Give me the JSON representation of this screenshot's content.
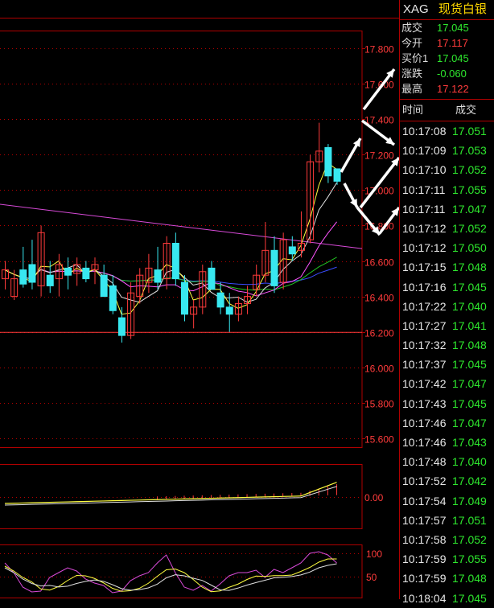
{
  "instrument": {
    "code": "XAG",
    "name": "现货白银"
  },
  "quote": [
    {
      "label": "成交",
      "value": "17.045",
      "color": "green"
    },
    {
      "label": "今开",
      "value": "17.117",
      "color": "red"
    },
    {
      "label": "买价1",
      "value": "17.045",
      "color": "green"
    },
    {
      "label": "涨跌",
      "value": "-0.060",
      "color": "green"
    },
    {
      "label": "最高",
      "value": "17.122",
      "color": "red"
    }
  ],
  "ticks_header": {
    "time": "时间",
    "price": "成交"
  },
  "ticks": [
    {
      "time": "10:17:08",
      "price": "17.051"
    },
    {
      "time": "10:17:09",
      "price": "17.053"
    },
    {
      "time": "10:17:10",
      "price": "17.052"
    },
    {
      "time": "10:17:11",
      "price": "17.055"
    },
    {
      "time": "10:17:11",
      "price": "17.047"
    },
    {
      "time": "10:17:12",
      "price": "17.052"
    },
    {
      "time": "10:17:12",
      "price": "17.050"
    },
    {
      "time": "10:17:15",
      "price": "17.048"
    },
    {
      "time": "10:17:16",
      "price": "17.045"
    },
    {
      "time": "10:17:22",
      "price": "17.040"
    },
    {
      "time": "10:17:27",
      "price": "17.041"
    },
    {
      "time": "10:17:32",
      "price": "17.048"
    },
    {
      "time": "10:17:37",
      "price": "17.045"
    },
    {
      "time": "10:17:42",
      "price": "17.047"
    },
    {
      "time": "10:17:43",
      "price": "17.045"
    },
    {
      "time": "10:17:46",
      "price": "17.047"
    },
    {
      "time": "10:17:46",
      "price": "17.043"
    },
    {
      "time": "10:17:48",
      "price": "17.040"
    },
    {
      "time": "10:17:52",
      "price": "17.042"
    },
    {
      "time": "10:17:54",
      "price": "17.049"
    },
    {
      "time": "10:17:57",
      "price": "17.051"
    },
    {
      "time": "10:17:58",
      "price": "17.052"
    },
    {
      "time": "10:17:59",
      "price": "17.055"
    },
    {
      "time": "10:17:59",
      "price": "17.048"
    },
    {
      "time": "10:18:04",
      "price": "17.045"
    }
  ],
  "colors": {
    "up": "#ff3b3b",
    "down": "#38e8f0",
    "grid": "#b00000",
    "accent_name": "#ffd800"
  },
  "chart_data": [
    {
      "type": "candlestick",
      "panel": "price",
      "yticks": [
        "17.800",
        "17.600",
        "17.400",
        "17.200",
        "17.000",
        "16.800",
        "16.600",
        "16.400",
        "16.200",
        "16.000",
        "15.800",
        "15.600"
      ],
      "ylim": [
        15.55,
        17.9
      ],
      "candles": [
        {
          "o": 16.5,
          "h": 16.6,
          "l": 16.44,
          "c": 16.55
        },
        {
          "o": 16.4,
          "h": 16.55,
          "l": 16.38,
          "c": 16.5
        },
        {
          "o": 16.55,
          "h": 16.68,
          "l": 16.45,
          "c": 16.47
        },
        {
          "o": 16.58,
          "h": 16.72,
          "l": 16.44,
          "c": 16.48
        },
        {
          "o": 16.46,
          "h": 16.8,
          "l": 16.4,
          "c": 16.76
        },
        {
          "o": 16.52,
          "h": 16.6,
          "l": 16.42,
          "c": 16.46
        },
        {
          "o": 16.5,
          "h": 16.64,
          "l": 16.4,
          "c": 16.58
        },
        {
          "o": 16.56,
          "h": 16.62,
          "l": 16.44,
          "c": 16.52
        },
        {
          "o": 16.53,
          "h": 16.62,
          "l": 16.46,
          "c": 16.58
        },
        {
          "o": 16.56,
          "h": 16.6,
          "l": 16.48,
          "c": 16.5
        },
        {
          "o": 16.55,
          "h": 16.62,
          "l": 16.47,
          "c": 16.58
        },
        {
          "o": 16.52,
          "h": 16.58,
          "l": 16.4,
          "c": 16.4
        },
        {
          "o": 16.46,
          "h": 16.52,
          "l": 16.3,
          "c": 16.32
        },
        {
          "o": 16.28,
          "h": 16.34,
          "l": 16.14,
          "c": 16.18
        },
        {
          "o": 16.18,
          "h": 16.48,
          "l": 16.16,
          "c": 16.42
        },
        {
          "o": 16.4,
          "h": 16.56,
          "l": 16.36,
          "c": 16.52
        },
        {
          "o": 16.48,
          "h": 16.64,
          "l": 16.42,
          "c": 16.56
        },
        {
          "o": 16.55,
          "h": 16.68,
          "l": 16.44,
          "c": 16.48
        },
        {
          "o": 16.5,
          "h": 16.74,
          "l": 16.44,
          "c": 16.7
        },
        {
          "o": 16.7,
          "h": 16.76,
          "l": 16.46,
          "c": 16.5
        },
        {
          "o": 16.48,
          "h": 16.52,
          "l": 16.26,
          "c": 16.3
        },
        {
          "o": 16.3,
          "h": 16.38,
          "l": 16.22,
          "c": 16.34
        },
        {
          "o": 16.34,
          "h": 16.58,
          "l": 16.3,
          "c": 16.54
        },
        {
          "o": 16.56,
          "h": 16.6,
          "l": 16.44,
          "c": 16.44
        },
        {
          "o": 16.42,
          "h": 16.48,
          "l": 16.3,
          "c": 16.34
        },
        {
          "o": 16.34,
          "h": 16.42,
          "l": 16.2,
          "c": 16.3
        },
        {
          "o": 16.3,
          "h": 16.4,
          "l": 16.26,
          "c": 16.36
        },
        {
          "o": 16.36,
          "h": 16.46,
          "l": 16.3,
          "c": 16.4
        },
        {
          "o": 16.44,
          "h": 16.58,
          "l": 16.4,
          "c": 16.52
        },
        {
          "o": 16.52,
          "h": 16.82,
          "l": 16.48,
          "c": 16.66
        },
        {
          "o": 16.66,
          "h": 16.74,
          "l": 16.42,
          "c": 16.46
        },
        {
          "o": 16.48,
          "h": 16.76,
          "l": 16.44,
          "c": 16.72
        },
        {
          "o": 16.68,
          "h": 16.74,
          "l": 16.6,
          "c": 16.64
        },
        {
          "o": 16.66,
          "h": 16.88,
          "l": 16.62,
          "c": 16.7
        },
        {
          "o": 16.72,
          "h": 17.2,
          "l": 16.7,
          "c": 17.16
        },
        {
          "o": 17.16,
          "h": 17.38,
          "l": 17.1,
          "c": 17.22
        },
        {
          "o": 17.24,
          "h": 17.26,
          "l": 17.04,
          "c": 17.08
        },
        {
          "o": 17.12,
          "h": 17.12,
          "l": 17.03,
          "c": 17.05
        }
      ],
      "arrows": [
        [
          [
            424,
            214
          ],
          [
            448,
            172
          ]
        ],
        [
          [
            452,
            136
          ],
          [
            490,
            86
          ]
        ],
        [
          [
            450,
            150
          ],
          [
            490,
            180
          ]
        ],
        [
          [
            428,
            228
          ],
          [
            444,
            258
          ]
        ],
        [
          [
            448,
            258
          ],
          [
            496,
            196
          ]
        ],
        [
          [
            444,
            258
          ],
          [
            472,
            292
          ]
        ],
        [
          [
            472,
            290
          ],
          [
            496,
            258
          ]
        ]
      ]
    },
    {
      "type": "line",
      "panel": "volume",
      "yticks": [
        "0.00"
      ]
    },
    {
      "type": "line",
      "panel": "oscillator",
      "yticks": [
        "100",
        "50"
      ]
    }
  ]
}
